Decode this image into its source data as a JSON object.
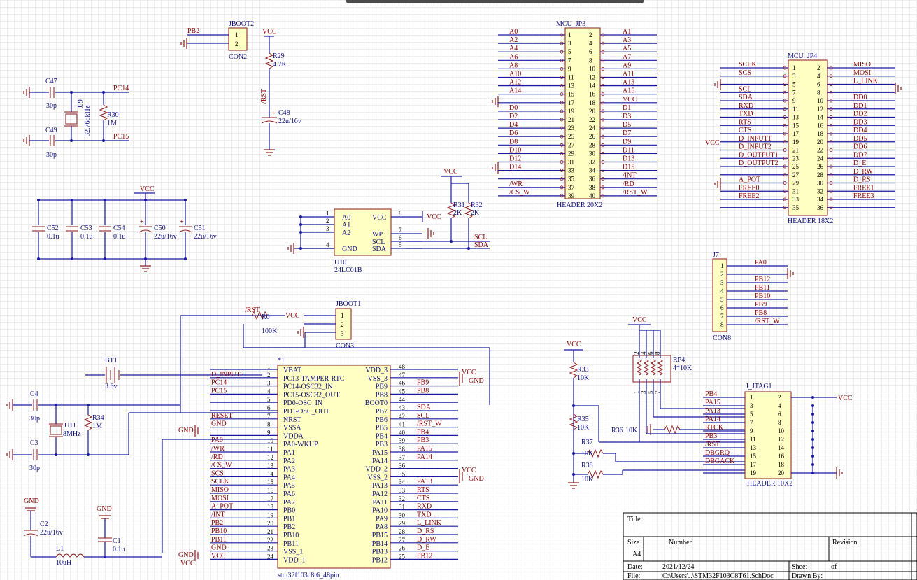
{
  "jboot2": {
    "ref": "JBOOT2",
    "type": "CON2",
    "pins": [
      "1",
      "2"
    ],
    "net": "PB2"
  },
  "r29": {
    "ref": "R29",
    "val": "4.7K",
    "vcc": "VCC",
    "net": "/RST"
  },
  "c48": {
    "ref": "C48",
    "val": "22u/16v"
  },
  "crystal32": {
    "c47": "C47",
    "c47v": "30p",
    "c49": "C49",
    "c49v": "30p",
    "jj9": "JJ9",
    "jj9v": "32.768kHz",
    "r30": "R30",
    "r30v": "1M",
    "pc14": "PC14",
    "pc15": "PC15"
  },
  "decoup": {
    "vcc": "VCC",
    "caps": [
      {
        "ref": "C52",
        "val": "0.1u"
      },
      {
        "ref": "C53",
        "val": "0.1u"
      },
      {
        "ref": "C54",
        "val": "0.1u"
      },
      {
        "ref": "C50",
        "val": "22u/16v"
      },
      {
        "ref": "C51",
        "val": "22u/16v"
      }
    ]
  },
  "u10": {
    "ref": "U10",
    "type": "24LC01B",
    "left": [
      "A0",
      "A1",
      "A2",
      "GND"
    ],
    "leftNums": [
      "1",
      "2",
      "3",
      "4"
    ],
    "right": [
      "VCC",
      "WP",
      "SCL",
      "SDA"
    ],
    "rightNums": [
      "8",
      "7",
      "6",
      "5"
    ],
    "vcc": "VCC",
    "scl": "SCL",
    "sda": "SDA"
  },
  "pullups": {
    "vcc": "VCC",
    "r31": "R31",
    "r31v": "2K",
    "r32": "R32",
    "r32v": "2K"
  },
  "jp3": {
    "ref": "MCU_JP3",
    "type": "HEADER 20X2",
    "leftNets": [
      "A0",
      "A2",
      "A4",
      "A6",
      "A8",
      "A10",
      "A12",
      "A14",
      "",
      "D0",
      "D2",
      "D4",
      "D6",
      "D8",
      "D10",
      "D12",
      "D14",
      "",
      "/WR",
      "/CS_W"
    ],
    "rightNets": [
      "A1",
      "A3",
      "A5",
      "A7",
      "A9",
      "A11",
      "A13",
      "A15",
      "VCC",
      "D1",
      "D3",
      "D5",
      "D7",
      "D9",
      "D11",
      "D13",
      "D15",
      "/INT",
      "/RD",
      "/RST_W"
    ],
    "leftPins": [
      "1",
      "3",
      "5",
      "7",
      "9",
      "11",
      "13",
      "15",
      "17",
      "19",
      "21",
      "23",
      "25",
      "27",
      "29",
      "31",
      "33",
      "35",
      "37",
      "39"
    ],
    "rightPins": [
      "2",
      "4",
      "6",
      "8",
      "10",
      "12",
      "14",
      "16",
      "18",
      "20",
      "22",
      "24",
      "26",
      "28",
      "30",
      "32",
      "34",
      "36",
      "38",
      "40"
    ]
  },
  "jp4": {
    "ref": "MCU_JP4",
    "type": "HEADER 18X2",
    "leftNets": [
      "SCLK",
      "SCS",
      "",
      "SCL",
      "SDA",
      "RXD",
      "TXD",
      "RTS",
      "CTS",
      "D_INPUT1",
      "D_INPUT2",
      "D_OUTPUT1",
      "D_OUTPUT2",
      "",
      "A_POT",
      "FREE0",
      "FREE2",
      ""
    ],
    "rightNets": [
      "MISO",
      "MOSI",
      "L_LINK",
      "",
      "DD0",
      "DD1",
      "DD2",
      "DD3",
      "DD4",
      "DD5",
      "DD6",
      "DD7",
      "D_E",
      "D_RW",
      "D_RS",
      "FREE1",
      "FREE3",
      ""
    ],
    "leftPins": [
      "1",
      "3",
      "5",
      "7",
      "9",
      "11",
      "13",
      "15",
      "17",
      "19",
      "21",
      "23",
      "25",
      "27",
      "29",
      "31",
      "33",
      "35"
    ],
    "rightPins": [
      "2",
      "4",
      "6",
      "8",
      "10",
      "12",
      "14",
      "16",
      "18",
      "20",
      "22",
      "24",
      "26",
      "28",
      "30",
      "32",
      "34",
      "36"
    ],
    "vcc": "VCC"
  },
  "j7": {
    "ref": "J7",
    "type": "CON8",
    "pins": [
      "1",
      "2",
      "3",
      "4",
      "5",
      "6",
      "7",
      "8"
    ],
    "nets": [
      "PA0",
      "",
      "PB12",
      "PB11",
      "PB10",
      "PB9",
      "PB8",
      "/RST_W"
    ]
  },
  "jboot1": {
    "ref": "JBOOT1",
    "type": "CON3",
    "pins": [
      "1",
      "2",
      "3"
    ],
    "r0": "R0",
    "r0v": "100K",
    "rst": "/RST",
    "vcc": "VCC"
  },
  "bt1": {
    "ref": "BT1",
    "val": "3.6v"
  },
  "u1": {
    "ref": "*1",
    "type": "stm32f103c8t6_48pin",
    "leftNames": [
      "VBAT",
      "PC13-TAMPER-RTC",
      "PC14-OSC32_IN",
      "PC15-OSC32_OUT",
      "PD0-OSC_IN",
      "PD1-OSC_OUT",
      "NRST",
      "VSSA",
      "VDDA",
      "PA0-WKUP",
      "PA1",
      "PA2",
      "PA3",
      "PA4",
      "PA5",
      "PA6",
      "PA7",
      "PB0",
      "PB1",
      "PB2",
      "PB10",
      "PB11",
      "VSS_1",
      "VDD_1"
    ],
    "leftNums": [
      "1",
      "2",
      "3",
      "4",
      "5",
      "6",
      "7",
      "8",
      "9",
      "10",
      "11",
      "12",
      "13",
      "14",
      "15",
      "16",
      "17",
      "18",
      "19",
      "20",
      "21",
      "22",
      "23",
      "24"
    ],
    "leftNets": [
      "",
      "D_INPUT2",
      "PC14",
      "PC15",
      "",
      "",
      "RESET",
      "GND",
      "",
      "PA0",
      "/WR",
      "/RD",
      "/CS_W",
      "SCS",
      "SCLK",
      "MISO",
      "MOSI",
      "A_POT",
      "/INT",
      "PB2",
      "PB10",
      "PB11",
      "GND",
      "VCC"
    ],
    "rightNames": [
      "VDD_3",
      "VSS_3",
      "PB9",
      "PB8",
      "BOOT0",
      "PB7",
      "PB6",
      "PB5",
      "PB4",
      "PB3",
      "PA15",
      "PA14",
      "VDD_2",
      "VSS_2",
      "PA13",
      "PA12",
      "PA11",
      "PA10",
      "PA9",
      "PA8",
      "PB15",
      "PB14",
      "PB13",
      "PB12"
    ],
    "rightNums": [
      "48",
      "47",
      "46",
      "45",
      "44",
      "43",
      "42",
      "41",
      "40",
      "39",
      "38",
      "37",
      "36",
      "35",
      "34",
      "33",
      "32",
      "31",
      "30",
      "29",
      "28",
      "27",
      "26",
      "25"
    ],
    "rightNets": [
      "",
      "",
      "PB9",
      "PB8",
      "",
      "SDA",
      "SCL",
      "/RST_W",
      "PB4",
      "PB3",
      "PA15",
      "PA14",
      "",
      "",
      "PA13",
      "RTS",
      "CTS",
      "RXD",
      "TXD",
      "L_LINK",
      "D_RS",
      "D_RW",
      "D_E",
      "PB12"
    ],
    "vcc": "VCC",
    "gnd": "GND"
  },
  "osc": {
    "c4": "C4",
    "c4v": "30p",
    "c3": "C3",
    "c3v": "30p",
    "u11": "U11",
    "u11v": "8MHz",
    "r34": "R34",
    "r34v": "1M"
  },
  "power": {
    "gnd": "GND",
    "c2": "C2",
    "c2v": "22u/16v",
    "l1": "L1",
    "l1v": "10uH",
    "c1": "C1",
    "c1v": "0.1u"
  },
  "jtagres": {
    "vcc": "VCC",
    "r33": "R33",
    "r33v": "10K",
    "r35": "R35",
    "r35v": "10K",
    "r36": "R36",
    "r36v": "10K",
    "r37": "R37",
    "r37v": "10K",
    "r38": "R38",
    "r38v": "10K",
    "rp4": "RP4",
    "rp4v": "4*10K",
    "rpTop": [
      "2",
      "4",
      "6",
      "8"
    ],
    "rpBot": [
      "1",
      "3",
      "5",
      "7"
    ]
  },
  "jtag": {
    "ref": "J_JTAG1",
    "type": "HEADER 10X2",
    "leftNets": [
      "PB4",
      "PA15",
      "PA13",
      "PA14",
      "RTCK",
      "PB3",
      "/RST",
      "DBGRQ",
      "DBGACK",
      ""
    ],
    "leftPins": [
      "1",
      "3",
      "5",
      "7",
      "9",
      "11",
      "13",
      "15",
      "17",
      "19"
    ],
    "rightPins": [
      "2",
      "4",
      "6",
      "8",
      "10",
      "12",
      "14",
      "16",
      "18",
      "20"
    ],
    "vcc": "VCC"
  },
  "title": {
    "title": "Title",
    "size": "Size",
    "sizeVal": "A4",
    "number": "Number",
    "revision": "Revision",
    "date": "Date:",
    "dateVal": "2021/12/24",
    "file": "File:",
    "fileVal": "C:\\Users\\..\\STM32F103C8T61.SchDoc",
    "sheet": "Sheet",
    "of": "of",
    "drawn": "Drawn By:"
  }
}
